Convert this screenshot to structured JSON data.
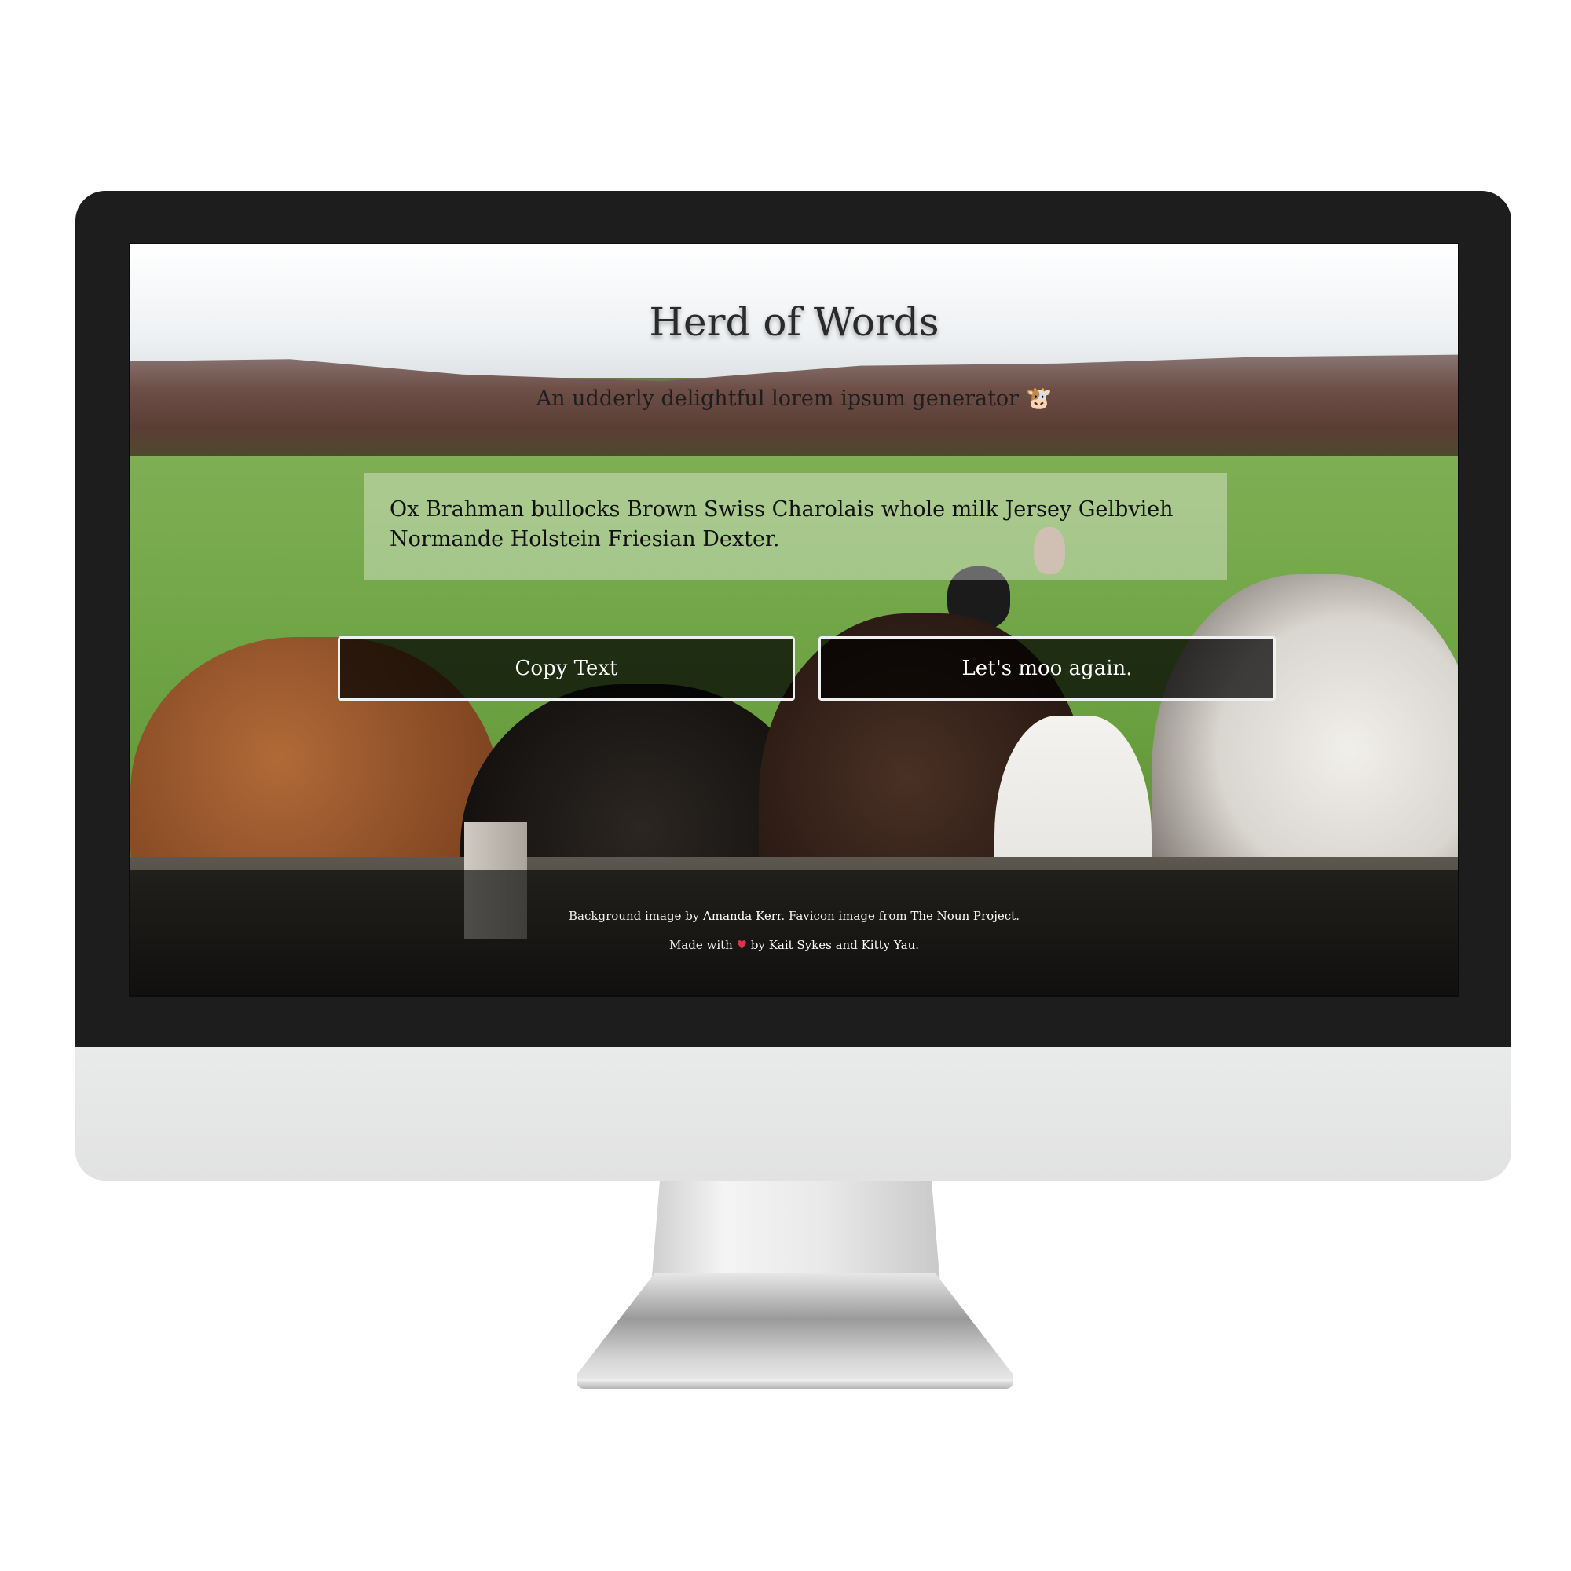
{
  "app": {
    "title": "Herd of Words",
    "tagline": "An udderly delightful lorem ipsum generator",
    "tagline_icon": "cow-face-icon"
  },
  "generated_text": "Ox Brahman bullocks Brown Swiss Charolais whole milk Jersey Gelbvieh Normande Holstein Friesian Dexter.",
  "buttons": {
    "copy_label": "Copy Text",
    "regenerate_label": "Let's moo again."
  },
  "footer": {
    "bg_prefix": "Background image by ",
    "bg_author": "Amanda Kerr",
    "favicon_middle": ". Favicon image from ",
    "favicon_source": "The Noun Project",
    "line1_end": ".",
    "made_prefix": "Made with ",
    "heart_icon": "heart-icon",
    "by_text": " by ",
    "author1": "Kait Sykes",
    "and_text": " and ",
    "author2": "Kitty Yau",
    "line2_end": "."
  },
  "colors": {
    "bezel": "#1d1d1d",
    "chin": "#e4e5e4",
    "button_border": "#f0f0f0",
    "heart": "#d8354a"
  }
}
